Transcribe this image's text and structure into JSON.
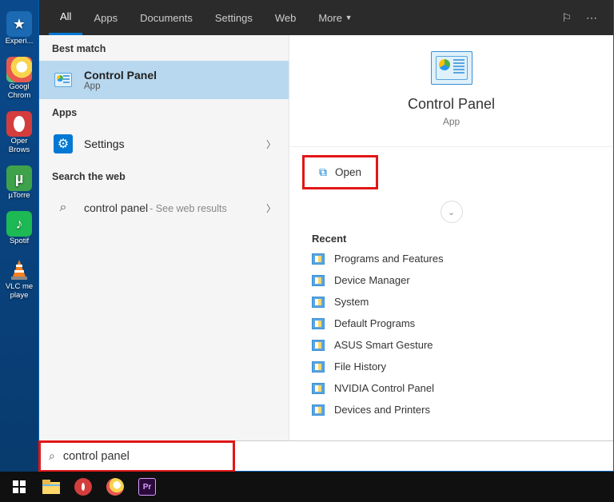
{
  "desktop_icons": [
    {
      "label": "Experi..."
    },
    {
      "label": "Googl Chrom"
    },
    {
      "label": "Oper Brows"
    },
    {
      "label": "µTorre"
    },
    {
      "label": "Spotif"
    },
    {
      "label": "VLC me playe"
    }
  ],
  "tabs": [
    "All",
    "Apps",
    "Documents",
    "Settings",
    "Web",
    "More"
  ],
  "sections": {
    "best_match": "Best match",
    "apps": "Apps",
    "search_web": "Search the web"
  },
  "best_match": {
    "title": "Control Panel",
    "sub": "App"
  },
  "apps_row": {
    "title": "Settings"
  },
  "web_row": {
    "query": "control panel",
    "hint": " - See web results"
  },
  "hero": {
    "title": "Control Panel",
    "sub": "App"
  },
  "open_label": "Open",
  "recent_label": "Recent",
  "recent": [
    "Programs and Features",
    "Device Manager",
    "System",
    "Default Programs",
    "ASUS Smart Gesture",
    "File History",
    "NVIDIA Control Panel",
    "Devices and Printers"
  ],
  "search_value": "control panel"
}
